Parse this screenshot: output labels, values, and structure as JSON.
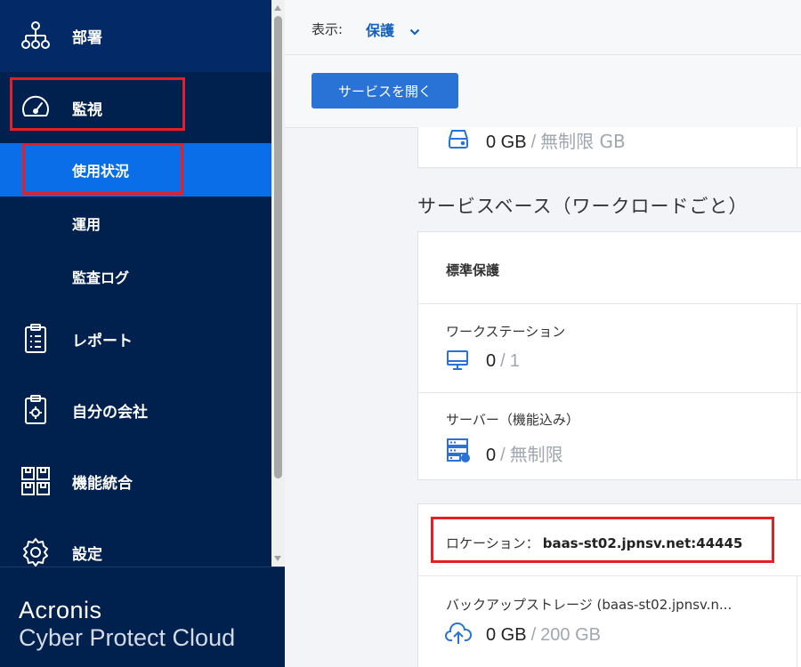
{
  "sidebar": {
    "items": [
      {
        "label": "部署",
        "icon": "sitemap-icon"
      },
      {
        "label": "監視",
        "icon": "gauge-icon"
      },
      {
        "label": "使用状況"
      },
      {
        "label": "運用"
      },
      {
        "label": "監査ログ"
      },
      {
        "label": "レポート",
        "icon": "clipboard-report-icon"
      },
      {
        "label": "自分の会社",
        "icon": "clipboard-gear-icon"
      },
      {
        "label": "機能統合",
        "icon": "modules-icon"
      },
      {
        "label": "設定",
        "icon": "gear-icon"
      }
    ],
    "brand_name": "Acronis",
    "brand_product": "Cyber Protect Cloud"
  },
  "topbar": {
    "view_label": "表示:",
    "view_value": "保護"
  },
  "toolbar": {
    "open_service_label": "サービスを開く"
  },
  "storage_card": {
    "used": "0 GB",
    "separator": "/",
    "total": "無制限 GB"
  },
  "section": {
    "title": "サービスベース（ワークロードごと）"
  },
  "standard_protection": {
    "title": "標準保護",
    "workstations": {
      "label": "ワークステーション",
      "used": "0",
      "separator": "/",
      "total": "1"
    },
    "servers": {
      "label": "サーバー（機能込み）",
      "used": "0",
      "separator": "/",
      "total": "無制限"
    }
  },
  "location_card": {
    "label": "ロケーション：",
    "value": "baas-st02.jpnsv.net:44445",
    "backup_label": "バックアップストレージ (baas-st02.jpnsv.n...",
    "used": "0 GB",
    "separator": "/",
    "total": "200 GB"
  },
  "colors": {
    "sidebar_bg": "#00204e",
    "active_item": "#0a6ee8",
    "accent": "#2a73d6",
    "highlight": "#e41f26"
  }
}
